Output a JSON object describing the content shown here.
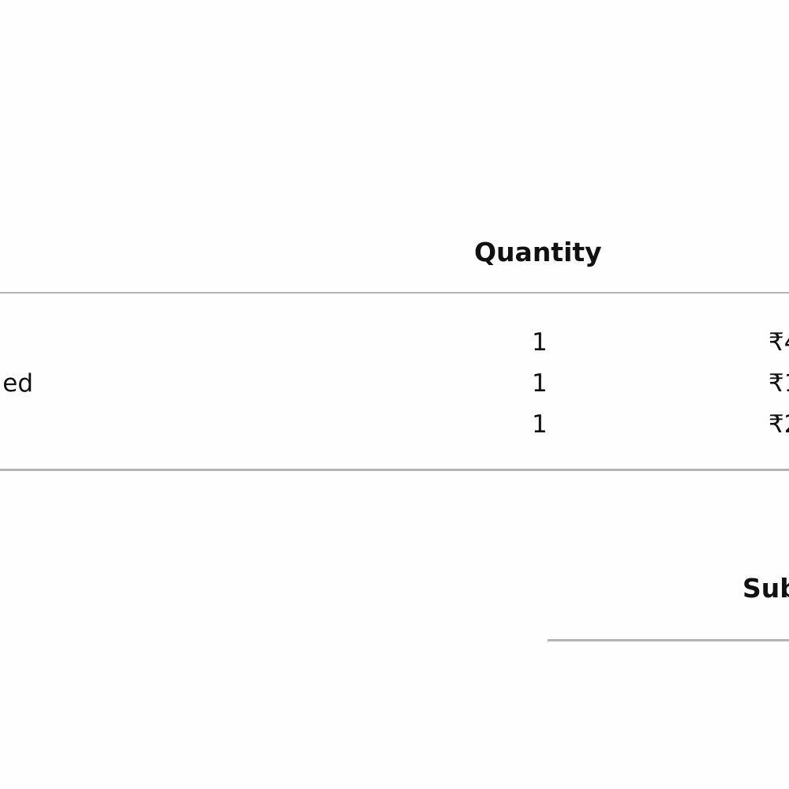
{
  "table": {
    "headers": {
      "quantity": "Quantity"
    },
    "rows": [
      {
        "name": "",
        "quantity": "1",
        "price": "₹4"
      },
      {
        "name": "ed",
        "quantity": "1",
        "price": "₹1"
      },
      {
        "name": "",
        "quantity": "1",
        "price": "₹2"
      }
    ]
  },
  "totals": {
    "subtotal_label": "Sub"
  }
}
